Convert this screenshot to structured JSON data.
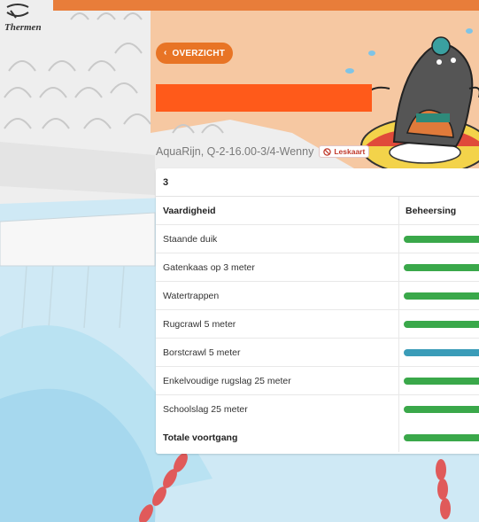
{
  "brand": {
    "logo_text": "Thermen"
  },
  "header": {
    "back_label": "OVERZICHT",
    "subtitle": "AquaRijn, Q-2-16.00-3/4-Wenny",
    "leskaart_label": "Leskaart"
  },
  "card": {
    "title": "3",
    "columns": {
      "skill": "Vaardigheid",
      "mastery": "Beheersing"
    },
    "rows": [
      {
        "name": "Staande duik",
        "status": "green"
      },
      {
        "name": "Gatenkaas op 3 meter",
        "status": "green"
      },
      {
        "name": "Watertrappen",
        "status": "green"
      },
      {
        "name": "Rugcrawl 5 meter",
        "status": "green"
      },
      {
        "name": "Borstcrawl 5 meter",
        "status": "blue"
      },
      {
        "name": "Enkelvoudige rugslag 25 meter",
        "status": "green"
      },
      {
        "name": "Schoolslag 25 meter",
        "status": "green"
      }
    ],
    "total_label": "Totale voortgang"
  },
  "colors": {
    "accent": "#e87425",
    "redacted": "#ff5a1a",
    "green": "#3aa84a",
    "blue": "#3a9cb8"
  }
}
